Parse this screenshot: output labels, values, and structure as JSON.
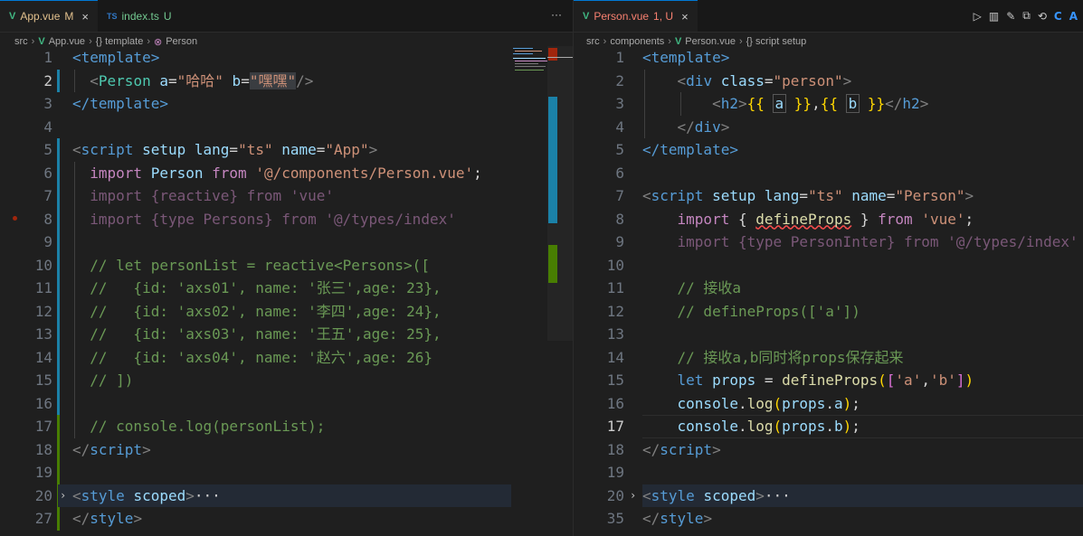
{
  "left": {
    "tabs": [
      {
        "icon": "V",
        "label": "App.vue",
        "status": "M",
        "active": true,
        "close": "×"
      },
      {
        "icon": "TS",
        "label": "index.ts",
        "status": "U",
        "active": false
      }
    ],
    "more": "···",
    "breadcrumb": {
      "src": "src",
      "file": "App.vue",
      "template": "{} template",
      "person": "Person"
    },
    "line_numbers": [
      "1",
      "2",
      "3",
      "4",
      "5",
      "6",
      "7",
      "8",
      "9",
      "10",
      "11",
      "12",
      "13",
      "14",
      "15",
      "16",
      "17",
      "18",
      "19",
      "20",
      "27"
    ],
    "code": {
      "l1": "<template>",
      "l2_tag": "Person",
      "l2_a": "a",
      "l2_aval": "\"哈哈\"",
      "l2_b": "b",
      "l2_bval": "\"嘿嘿\"",
      "l3": "</template>",
      "l5_tag": "script",
      "l5_setup": "setup",
      "l5_lang": "lang",
      "l5_langv": "\"ts\"",
      "l5_name": "name",
      "l5_namev": "\"App\"",
      "l6_import": "import",
      "l6_id": "Person",
      "l6_from": "from",
      "l6_path": "'@/components/Person.vue'",
      "l7": "import {reactive} from 'vue'",
      "l8": "import {type Persons} from '@/types/index'",
      "l10": "// let personList = reactive<Persons>([",
      "l11": "//   {id: 'axs01', name: '张三',age: 23},",
      "l12": "//   {id: 'axs02', name: '李四',age: 24},",
      "l13": "//   {id: 'axs03', name: '王五',age: 25},",
      "l14": "//   {id: 'axs04', name: '赵六',age: 26}",
      "l15": "// ])",
      "l17": "// console.log(personList);",
      "l18_tag": "script",
      "l20_tag": "style",
      "l20_attr": "scoped",
      "l20_ellipsis": "···",
      "l27_tag": "style"
    }
  },
  "right": {
    "tab": {
      "icon": "V",
      "label": "Person.vue",
      "status": "1, U",
      "close": "×"
    },
    "actions": [
      "▷",
      "▥",
      "✎",
      "⧉",
      "⟲",
      "C",
      "A"
    ],
    "breadcrumb": {
      "src": "src",
      "components": "components",
      "file": "Person.vue",
      "scope": "{} script setup"
    },
    "line_numbers": [
      "1",
      "2",
      "3",
      "4",
      "5",
      "6",
      "7",
      "8",
      "9",
      "10",
      "11",
      "12",
      "13",
      "14",
      "15",
      "16",
      "17",
      "18",
      "19",
      "20",
      "35"
    ],
    "code": {
      "l1": "<template>",
      "l2_tag": "div",
      "l2_attr": "class",
      "l2_val": "\"person\"",
      "l3_tag": "h2",
      "l3_a": "a",
      "l3_b": "b",
      "l4_tag": "div",
      "l5": "</template>",
      "l7_tag": "script",
      "l7_setup": "setup",
      "l7_lang": "lang",
      "l7_langv": "\"ts\"",
      "l7_name": "name",
      "l7_namev": "\"Person\"",
      "l8_import": "import",
      "l8_fn": "defineProps",
      "l8_from": "from",
      "l8_path": "'vue'",
      "l9": "import {type PersonInter} from '@/types/index'",
      "l11": "// 接收a",
      "l12": "// defineProps(['a'])",
      "l14": "// 接收a,b同时将props保存起来",
      "l15_let": "let",
      "l15_var": "props",
      "l15_fn": "defineProps",
      "l15_a": "'a'",
      "l15_b": "'b'",
      "l16_obj": "console",
      "l16_fn": "log",
      "l16_arg": "props",
      "l16_prop": "a",
      "l17_obj": "console",
      "l17_fn": "log",
      "l17_arg": "props",
      "l17_prop": "b",
      "l18_tag": "script",
      "l20_tag": "style",
      "l20_attr": "scoped",
      "l20_ellipsis": "···",
      "l35_tag": "style"
    }
  },
  "colors": {
    "accent": "#0078d4",
    "vue": "#41b883",
    "modified": "#e2c08d",
    "untracked": "#73c991",
    "error": "#f88070"
  }
}
